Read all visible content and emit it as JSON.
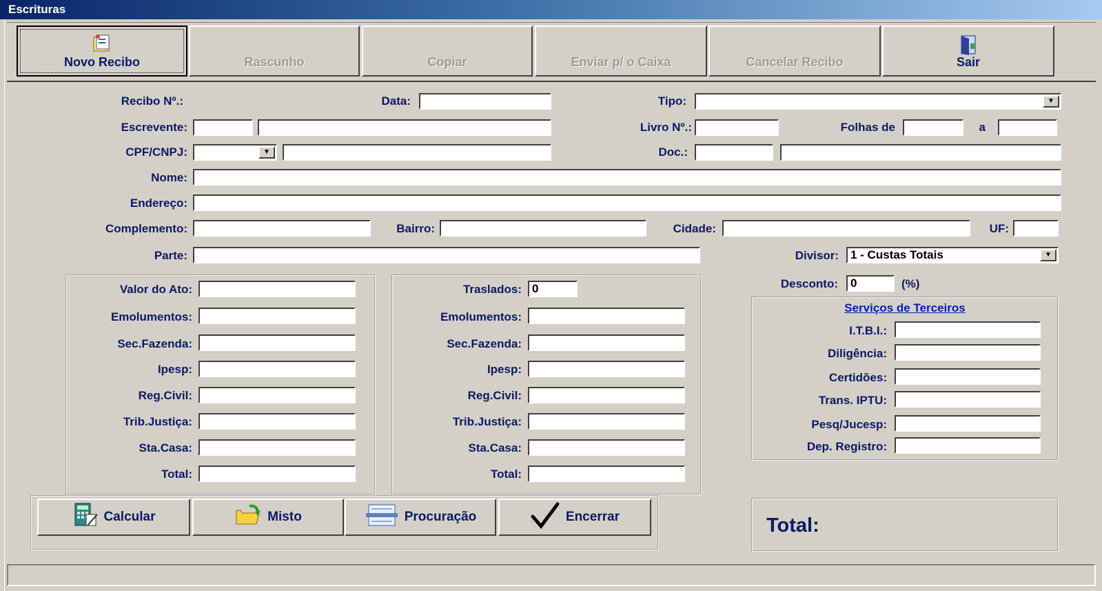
{
  "window": {
    "title": "Escrituras"
  },
  "toolbar": {
    "novo_recibo": "Novo Recibo",
    "rascunho": "Rascunho",
    "copiar": "Copiar",
    "enviar_caixa": "Enviar p/ o Caixa",
    "cancelar_recibo": "Cancelar Recibo",
    "sair": "Sair"
  },
  "form": {
    "recibo_label": "Recibo Nº.:",
    "data_label": "Data:",
    "tipo_label": "Tipo:",
    "escrevente_label": "Escrevente:",
    "livro_label": "Livro Nº.:",
    "folhas_label": "Folhas de",
    "a_label": "a",
    "cpf_label": "CPF/CNPJ:",
    "doc_label": "Doc.:",
    "nome_label": "Nome:",
    "endereco_label": "Endereço:",
    "complemento_label": "Complemento:",
    "bairro_label": "Bairro:",
    "cidade_label": "Cidade:",
    "uf_label": "UF:",
    "parte_label": "Parte:",
    "divisor_label": "Divisor:",
    "divisor_value": "1 - Custas Totais",
    "desconto_label": "Desconto:",
    "desconto_value": "0",
    "desconto_unit": "(%)"
  },
  "left_group": {
    "valor_ato": "Valor do Ato:",
    "emolumentos": "Emolumentos:",
    "sec_fazenda": "Sec.Fazenda:",
    "ipesp": "Ipesp:",
    "reg_civil": "Reg.Civil:",
    "trib_justica": "Trib.Justiça:",
    "sta_casa": "Sta.Casa:",
    "total": "Total:"
  },
  "mid_group": {
    "traslados": "Traslados:",
    "traslados_value": "0",
    "emolumentos": "Emolumentos:",
    "sec_fazenda": "Sec.Fazenda:",
    "ipesp": "Ipesp:",
    "reg_civil": "Reg.Civil:",
    "trib_justica": "Trib.Justiça:",
    "sta_casa": "Sta.Casa:",
    "total": "Total:"
  },
  "terceiros": {
    "title": "Serviços de Terceiros",
    "itbi": "I.T.B.I.:",
    "diligencia": "Diligência:",
    "certidoes": "Certidões:",
    "trans_iptu": "Trans. IPTU:",
    "pesq_jucesp": "Pesq/Jucesp:",
    "dep_registro": "Dep. Registro:"
  },
  "actions": {
    "calcular": "Calcular",
    "misto": "Misto",
    "procuracao": "Procuração",
    "encerrar": "Encerrar"
  },
  "total_panel": {
    "label": "Total:"
  }
}
